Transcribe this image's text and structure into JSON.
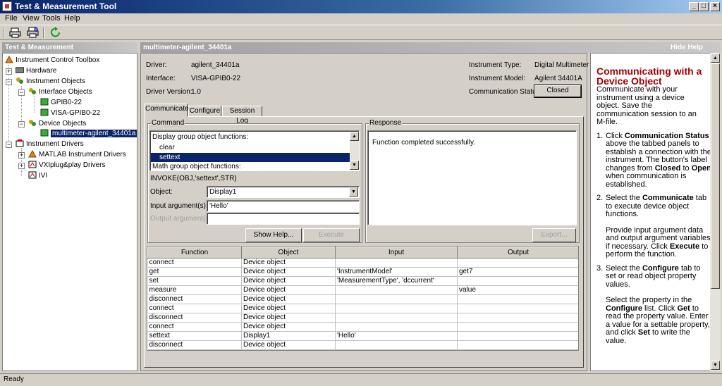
{
  "window": {
    "title": "Test & Measurement Tool"
  },
  "menu": [
    "File",
    "View",
    "Tools",
    "Help"
  ],
  "left_header": "Test & Measurement",
  "main_header": "multimeter-agilent_34401a",
  "hide_help": "Hide Help",
  "tree": {
    "root": "Instrument Control Toolbox",
    "hardware": "Hardware",
    "instrument_objects": "Instrument Objects",
    "interface_objects": "Interface Objects",
    "gpib": "GPIB0-22",
    "visa": "VISA-GPIB0-22",
    "device_objects": "Device Objects",
    "device": "multimeter-agilent_34401a",
    "instrument_drivers": "Instrument Drivers",
    "matlab_drivers": "MATLAB Instrument Drivers",
    "vxi_drivers": "VXIplug&play Drivers",
    "ivi": "IVI"
  },
  "info": {
    "driver_label": "Driver:",
    "driver": "agilent_34401a",
    "interface_label": "Interface:",
    "interface": "VISA-GPIB0-22",
    "version_label": "Driver Version:",
    "version": "1.0",
    "type_label": "Instrument Type:",
    "type": "Digital Multimeter",
    "model_label": "Instrument Model:",
    "model": "Agilent 34401A",
    "status_label": "Communication Status:",
    "status": "Closed"
  },
  "tabs": [
    "Communicate",
    "Configure",
    "Session Log"
  ],
  "command": {
    "label": "Command",
    "list": [
      "Display group object functions:",
      "clear",
      "settext",
      "Math group object functions:"
    ],
    "invoke": "INVOKE(OBJ,'settext',STR)",
    "object_label": "Object:",
    "object": "Display1",
    "input_label": "Input argument(s):",
    "input": "'Hello'",
    "output_label": "Output argument(s):",
    "show_help": "Show Help...",
    "execute": "Execute"
  },
  "response": {
    "label": "Response",
    "text": "Function completed successfully.",
    "export": "Export..."
  },
  "table": {
    "headers": [
      "Function",
      "Object",
      "Input",
      "Output"
    ],
    "rows": [
      [
        "connect",
        "Device object",
        "",
        ""
      ],
      [
        "get",
        "Device object",
        "'InstrumentModel'",
        "get7"
      ],
      [
        "set",
        "Device object",
        "'MeasurementType', 'dccurrent'",
        ""
      ],
      [
        "measure",
        "Device object",
        "",
        "value"
      ],
      [
        "disconnect",
        "Device object",
        "",
        ""
      ],
      [
        "connect",
        "Device object",
        "",
        ""
      ],
      [
        "disconnect",
        "Device object",
        "",
        ""
      ],
      [
        "connect",
        "Device object",
        "",
        ""
      ],
      [
        "settext",
        "Display1",
        "'Hello'",
        ""
      ],
      [
        "disconnect",
        "Device object",
        "",
        ""
      ]
    ]
  },
  "help": {
    "title": "Communicating with a Device Object",
    "intro": "Communicate with your instrument using a device object. Save the communication session to an M-file.",
    "s1_num": "1.",
    "s1a": "Click ",
    "s1b": "Communication Status",
    "s1c": " above the tabbed panels to establish a connection with the instrument. The button's label changes from ",
    "s1d": "Closed",
    "s1e": " to ",
    "s1f": "Open",
    "s1g": " when communication is established.",
    "s2_num": "2.",
    "s2a": "Select the ",
    "s2b": "Communicate",
    "s2c": " tab to execute device object functions.",
    "s2p_a": "Provide input argument data and output argument variables if necessary. Click ",
    "s2p_b": "Execute",
    "s2p_c": " to perform the function.",
    "s3_num": "3.",
    "s3a": "Select the ",
    "s3b": "Configure",
    "s3c": " tab to set or read object property values.",
    "s3p_a": "Select the property in the ",
    "s3p_b": "Configure",
    "s3p_c": " list. Click ",
    "s3p_d": "Get",
    "s3p_e": " to read the property value. Enter a value for a settable property, and click ",
    "s3p_f": "Set",
    "s3p_g": " to write the value."
  },
  "status": "Ready",
  "colors": {
    "title_bar": "#0a246a",
    "selection": "#0a246a",
    "help_title": "#a00000"
  }
}
